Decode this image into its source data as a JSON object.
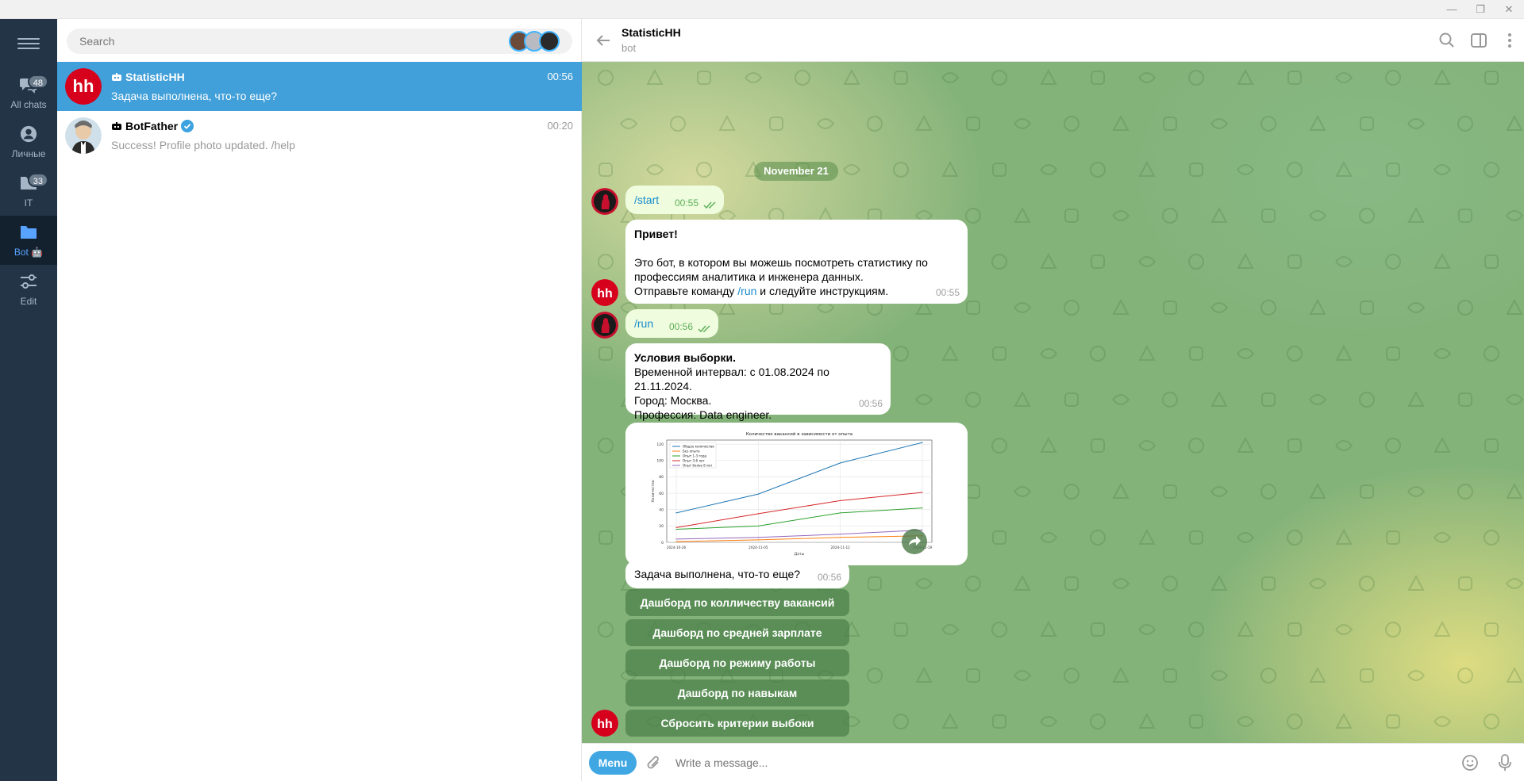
{
  "window": {
    "min_glyph": "—",
    "restore_glyph": "❐",
    "close_glyph": "✕"
  },
  "folders": [
    {
      "label": "All chats",
      "badge": "48",
      "icon": "chats-icon"
    },
    {
      "label": "Личные",
      "badge": "",
      "icon": "person-icon"
    },
    {
      "label": "IT",
      "badge": "33",
      "icon": "folder-icon"
    },
    {
      "label": "Bot 🤖",
      "badge": "",
      "icon": "folder-icon",
      "active": true
    },
    {
      "label": "Edit",
      "badge": "",
      "icon": "sliders-icon"
    }
  ],
  "search": {
    "placeholder": "Search"
  },
  "chats": [
    {
      "name": "StatisticHH",
      "time": "00:56",
      "snippet": "Задача выполнена, что-то еще?",
      "active": true
    },
    {
      "name": "BotFather",
      "time": "00:20",
      "snippet": "Success! Profile photo updated. /help",
      "verified": true
    }
  ],
  "header": {
    "title": "StatisticHH",
    "status": "bot"
  },
  "conversation": {
    "date": "November 21",
    "msg_start": {
      "text": "/start",
      "time": "00:55"
    },
    "msg_hello": {
      "title": "Привет!",
      "line1": "Это бот, в котором вы можешь посмотреть статистику по",
      "line2": "профессиям аналитика и инженера данных.",
      "line3_pre": "Отправьте команду ",
      "line3_cmd": "/run",
      "line3_post": " и следуйте инструкциям.",
      "time": "00:55"
    },
    "msg_run": {
      "text": "/run",
      "time": "00:56"
    },
    "msg_conditions": {
      "title": "Условия выборки.",
      "line1": "Временной интервал: с 01.08.2024 по 21.11.2024.",
      "line2": "Город: Москва.",
      "line3": "Профессия: Data engineer.",
      "time": "00:56"
    },
    "msg_done": {
      "text": "Задача выполнена, что-то еще?",
      "time": "00:56"
    },
    "keyboard": [
      "Дашборд по колличеству вакансий",
      "Дашборд по средней зарплате",
      "Дашборд по режиму работы",
      "Дашборд по навыкам",
      "Сбросить критерии выбоки"
    ]
  },
  "chart_data": {
    "type": "line",
    "title": "Количество вакансий в зависимости от опыта",
    "xlabel": "Даты",
    "ylabel": "Количество",
    "x": [
      "2024-10-26",
      "2024-11-05",
      "2024-11-12",
      "2024-11-19"
    ],
    "ylim": [
      0,
      125
    ],
    "yticks": [
      "0",
      "20",
      "40",
      "60",
      "80",
      "100",
      "120"
    ],
    "grid": true,
    "legend": "top-left",
    "series": [
      {
        "name": "Общее количество",
        "color": "#1f77b4",
        "values": [
          36,
          59,
          97,
          122
        ]
      },
      {
        "name": "Без опыта",
        "color": "#ff7f0e",
        "values": [
          1,
          3,
          6,
          8
        ]
      },
      {
        "name": "Опыт 1-3 года",
        "color": "#2ca02c",
        "values": [
          16,
          20,
          36,
          42
        ]
      },
      {
        "name": "Опыт 3-6 лет",
        "color": "#d62728",
        "values": [
          18,
          35,
          51,
          61
        ]
      },
      {
        "name": "Опыт более 6 лет",
        "color": "#9467bd",
        "values": [
          4,
          6,
          10,
          15
        ]
      }
    ]
  },
  "composer": {
    "menu_label": "Menu",
    "placeholder": "Write a message..."
  },
  "colors": {
    "accent": "#419fd9",
    "sidebar": "#243447",
    "outgoing": "#effdde",
    "keyboard": "#4a8048"
  }
}
